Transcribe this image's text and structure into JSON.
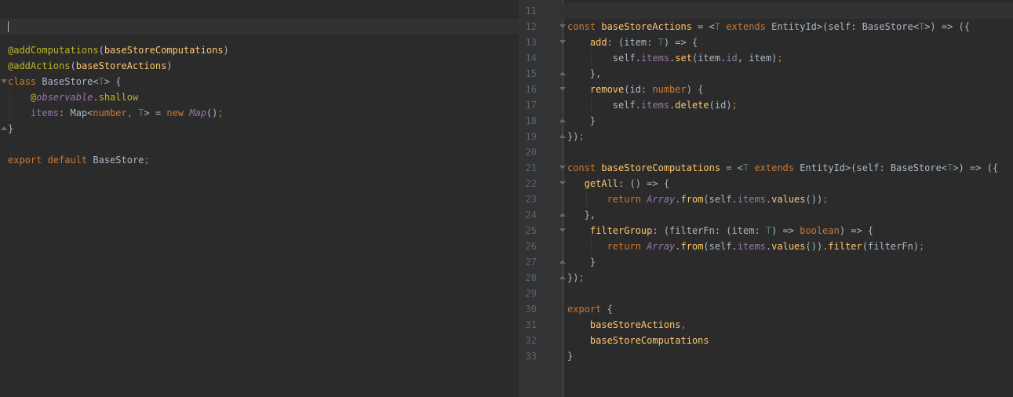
{
  "left_editor": {
    "lines": [
      {
        "segments": [
          {
            "t": "",
            "c": "plain"
          }
        ]
      },
      {
        "segments": [
          {
            "t": "@addComputations",
            "c": "ann"
          },
          {
            "t": "(",
            "c": "plain"
          },
          {
            "t": "baseStoreComputations",
            "c": "fn"
          },
          {
            "t": ")",
            "c": "plain"
          }
        ]
      },
      {
        "segments": [
          {
            "t": "@addActions",
            "c": "ann"
          },
          {
            "t": "(",
            "c": "plain"
          },
          {
            "t": "baseStoreActions",
            "c": "fn"
          },
          {
            "t": ")",
            "c": "plain"
          }
        ]
      },
      {
        "segments": [
          {
            "t": "class ",
            "c": "kw"
          },
          {
            "t": "BaseStore<",
            "c": "plain"
          },
          {
            "t": "T",
            "c": "type-param"
          },
          {
            "t": "> {",
            "c": "plain"
          }
        ]
      },
      {
        "segments": [
          {
            "t": "    @",
            "c": "ann"
          },
          {
            "t": "observable",
            "c": "ital"
          },
          {
            "t": ".shallow",
            "c": "ann"
          }
        ]
      },
      {
        "segments": [
          {
            "t": "    items",
            "c": "prop"
          },
          {
            "t": ": Map<",
            "c": "plain"
          },
          {
            "t": "number",
            "c": "kw"
          },
          {
            "t": ", ",
            "c": "kw"
          },
          {
            "t": "T",
            "c": "type-param"
          },
          {
            "t": "> = ",
            "c": "plain"
          },
          {
            "t": "new ",
            "c": "kw"
          },
          {
            "t": "Map",
            "c": "ital"
          },
          {
            "t": "()",
            "c": "plain"
          },
          {
            "t": ";",
            "c": "kw"
          }
        ]
      },
      {
        "segments": [
          {
            "t": "}",
            "c": "plain"
          }
        ]
      },
      {
        "segments": [
          {
            "t": "",
            "c": "plain"
          }
        ]
      },
      {
        "segments": [
          {
            "t": "export default ",
            "c": "kw"
          },
          {
            "t": "BaseStore",
            "c": "plain"
          },
          {
            "t": ";",
            "c": "kw"
          }
        ]
      }
    ]
  },
  "right_editor": {
    "line_numbers": [
      "11",
      "12",
      "13",
      "14",
      "15",
      "16",
      "17",
      "18",
      "19",
      "20",
      "21",
      "22",
      "23",
      "24",
      "25",
      "26",
      "27",
      "28",
      "29",
      "30",
      "31",
      "32",
      "33"
    ],
    "lines": [
      {
        "segments": [
          {
            "t": "",
            "c": "plain"
          }
        ]
      },
      {
        "segments": [
          {
            "t": "const ",
            "c": "kw"
          },
          {
            "t": "baseStoreActions",
            "c": "fn"
          },
          {
            "t": " = <",
            "c": "plain"
          },
          {
            "t": "T ",
            "c": "type-param"
          },
          {
            "t": "extends ",
            "c": "kw"
          },
          {
            "t": "EntityId>(self: BaseStore<",
            "c": "plain"
          },
          {
            "t": "T",
            "c": "type-param"
          },
          {
            "t": ">) => ({",
            "c": "plain"
          }
        ]
      },
      {
        "segments": [
          {
            "t": "    add",
            "c": "fn"
          },
          {
            "t": ": (item: ",
            "c": "plain"
          },
          {
            "t": "T",
            "c": "type-param"
          },
          {
            "t": ") => {",
            "c": "plain"
          }
        ]
      },
      {
        "segments": [
          {
            "t": "        self.",
            "c": "plain"
          },
          {
            "t": "items",
            "c": "prop"
          },
          {
            "t": ".",
            "c": "plain"
          },
          {
            "t": "set",
            "c": "fn"
          },
          {
            "t": "(item.",
            "c": "plain"
          },
          {
            "t": "id",
            "c": "prop"
          },
          {
            "t": ", item)",
            "c": "plain"
          },
          {
            "t": ";",
            "c": "kw"
          }
        ]
      },
      {
        "segments": [
          {
            "t": "    },",
            "c": "plain"
          }
        ]
      },
      {
        "segments": [
          {
            "t": "    remove",
            "c": "fn"
          },
          {
            "t": "(id: ",
            "c": "plain"
          },
          {
            "t": "number",
            "c": "kw"
          },
          {
            "t": ") {",
            "c": "plain"
          }
        ]
      },
      {
        "segments": [
          {
            "t": "        self.",
            "c": "plain"
          },
          {
            "t": "items",
            "c": "prop"
          },
          {
            "t": ".",
            "c": "plain"
          },
          {
            "t": "delete",
            "c": "fn"
          },
          {
            "t": "(id)",
            "c": "plain"
          },
          {
            "t": ";",
            "c": "kw"
          }
        ]
      },
      {
        "segments": [
          {
            "t": "    }",
            "c": "plain"
          }
        ]
      },
      {
        "segments": [
          {
            "t": "})",
            "c": "plain"
          },
          {
            "t": ";",
            "c": "kw"
          }
        ]
      },
      {
        "segments": [
          {
            "t": "",
            "c": "plain"
          }
        ]
      },
      {
        "segments": [
          {
            "t": "const ",
            "c": "kw"
          },
          {
            "t": "baseStoreComputations",
            "c": "fn"
          },
          {
            "t": " = <",
            "c": "plain"
          },
          {
            "t": "T ",
            "c": "type-param"
          },
          {
            "t": "extends ",
            "c": "kw"
          },
          {
            "t": "EntityId>(self: BaseStore<",
            "c": "plain"
          },
          {
            "t": "T",
            "c": "type-param"
          },
          {
            "t": ">) => ({",
            "c": "plain"
          }
        ]
      },
      {
        "segments": [
          {
            "t": "   getAll",
            "c": "fn"
          },
          {
            "t": ": () => {",
            "c": "plain"
          }
        ]
      },
      {
        "segments": [
          {
            "t": "       return ",
            "c": "kw"
          },
          {
            "t": "Array",
            "c": "ital"
          },
          {
            "t": ".",
            "c": "plain"
          },
          {
            "t": "from",
            "c": "fn"
          },
          {
            "t": "(self.",
            "c": "plain"
          },
          {
            "t": "items",
            "c": "prop"
          },
          {
            "t": ".",
            "c": "plain"
          },
          {
            "t": "values",
            "c": "fn"
          },
          {
            "t": "())",
            "c": "plain"
          },
          {
            "t": ";",
            "c": "kw"
          }
        ]
      },
      {
        "segments": [
          {
            "t": "   },",
            "c": "plain"
          }
        ]
      },
      {
        "segments": [
          {
            "t": "    filterGroup",
            "c": "fn"
          },
          {
            "t": ": (filterFn: (item: ",
            "c": "plain"
          },
          {
            "t": "T",
            "c": "type-param"
          },
          {
            "t": ") => ",
            "c": "plain"
          },
          {
            "t": "boolean",
            "c": "kw"
          },
          {
            "t": ") => {",
            "c": "plain"
          }
        ]
      },
      {
        "segments": [
          {
            "t": "       return ",
            "c": "kw"
          },
          {
            "t": "Array",
            "c": "ital"
          },
          {
            "t": ".",
            "c": "plain"
          },
          {
            "t": "from",
            "c": "fn"
          },
          {
            "t": "(self.",
            "c": "plain"
          },
          {
            "t": "items",
            "c": "prop"
          },
          {
            "t": ".",
            "c": "plain"
          },
          {
            "t": "values",
            "c": "fn"
          },
          {
            "t": "()).",
            "c": "plain"
          },
          {
            "t": "filter",
            "c": "fn"
          },
          {
            "t": "(filterFn)",
            "c": "plain"
          },
          {
            "t": ";",
            "c": "kw"
          }
        ]
      },
      {
        "segments": [
          {
            "t": "    }",
            "c": "plain"
          }
        ]
      },
      {
        "segments": [
          {
            "t": "})",
            "c": "plain"
          },
          {
            "t": ";",
            "c": "kw"
          }
        ]
      },
      {
        "segments": [
          {
            "t": "",
            "c": "plain"
          }
        ]
      },
      {
        "segments": [
          {
            "t": "export ",
            "c": "kw"
          },
          {
            "t": "{",
            "c": "plain"
          }
        ]
      },
      {
        "segments": [
          {
            "t": "    baseStoreActions",
            "c": "fn"
          },
          {
            "t": ",",
            "c": "kw"
          }
        ]
      },
      {
        "segments": [
          {
            "t": "    baseStoreComputations",
            "c": "fn"
          }
        ]
      },
      {
        "segments": [
          {
            "t": "}",
            "c": "plain"
          }
        ]
      }
    ]
  },
  "colors": {
    "background": "#2b2b2b",
    "gutter": "#313335",
    "keyword": "#cc7832",
    "annotation": "#bbb529",
    "function": "#ffc66d",
    "property": "#9876aa",
    "text": "#a9b7c6",
    "line_number": "#606366"
  }
}
